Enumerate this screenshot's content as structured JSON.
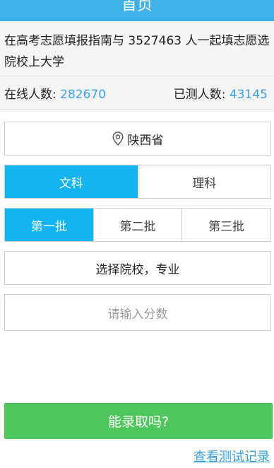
{
  "header": {
    "title": "首页"
  },
  "intro": {
    "text": "在高考志愿填报指南与 3527463 人一起填志愿选院校上大学"
  },
  "stats": {
    "online_label": "在线人数:",
    "online_value": "282670",
    "tested_label": "已测人数:",
    "tested_value": "43145"
  },
  "province": {
    "icon": "location-pin-icon",
    "label": "陕西省"
  },
  "subject_tabs": [
    {
      "label": "文科",
      "active": true
    },
    {
      "label": "理科",
      "active": false
    }
  ],
  "batch_tabs": [
    {
      "label": "第一批",
      "active": true
    },
    {
      "label": "第二批",
      "active": false
    },
    {
      "label": "第三批",
      "active": false
    }
  ],
  "school": {
    "label": "选择院校，专业"
  },
  "score": {
    "placeholder": "请输入分数"
  },
  "submit": {
    "label": "能录取吗?"
  },
  "history": {
    "label": "查看测试记录"
  },
  "colors": {
    "header": "#3fb0e8",
    "active_tab": "#13b5f0",
    "submit": "#4fc55e",
    "link": "#3ba0db"
  }
}
